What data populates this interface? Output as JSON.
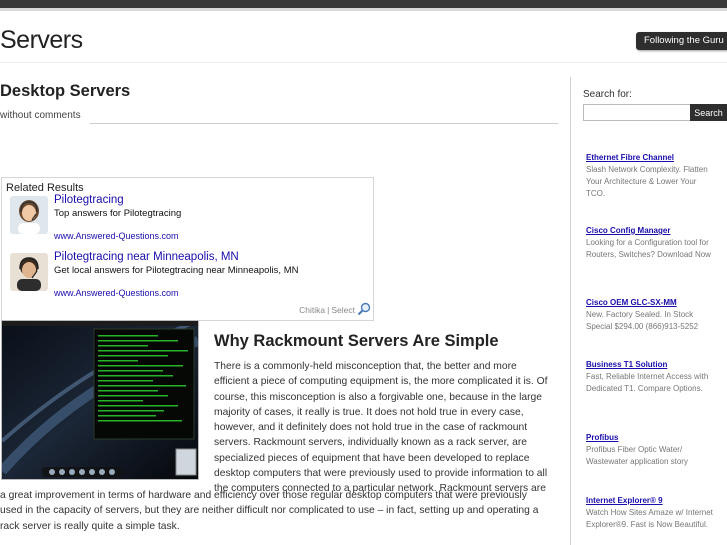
{
  "header": {
    "site_title": "Servers",
    "follow_label": "Following the Guru"
  },
  "post": {
    "title": "Desktop Servers",
    "comments": "without comments"
  },
  "related": {
    "heading": "Related Results",
    "ads": [
      {
        "title": "Pilotegtracing",
        "description": "Top answers for Pilotegtracing",
        "url": "www.Answered-Questions.com"
      },
      {
        "title": "Pilotegtracing near Minneapolis, MN",
        "description": "Get local answers for Pilotegtracing near Minneapolis, MN",
        "url": "www.Answered-Questions.com"
      }
    ],
    "footer_chitika": "Chitika",
    "footer_sep": " | ",
    "footer_select": "Select"
  },
  "article": {
    "title": "Why Rackmount Servers Are Simple",
    "lines_right": [
      "There is a commonly-held misconception that, the better and more",
      "efficient a piece of computing equipment is, the more complicated it is. Of",
      "course, this misconception is also a forgivable one, because in the large",
      "majority of cases, it really is true. It does not hold true in every case,",
      "however, and it definitely does not hold true in the case of rackmount",
      "servers. Rackmount servers, individually known as a rack server, are",
      "specialized pieces of equipment that have been developed to replace",
      "desktop computers that were previously used to provide information to all",
      "the computers connected to a particular network. Rackmount servers are"
    ],
    "lines_full": [
      "a great improvement in terms of hardware and efficiency over those regular desktop computers that were previously",
      "used in the capacity of servers, but they are neither difficult nor complicated to use – in fact, setting up and operating a",
      "rack server is really quite a simple task."
    ]
  },
  "sidebar": {
    "search_label": "Search for:",
    "search_value": "",
    "search_button": "Search",
    "ads": [
      {
        "title": "Ethernet Fibre Channel",
        "description": "Slash Network Complexity. Flatten Your Architecture & Lower Your TCO."
      },
      {
        "title": "Cisco Config Manager",
        "description": "Looking for a Configuration tool for Routers, Switches? Download Now"
      },
      {
        "title": "Cisco OEM GLC-SX-MM",
        "description": "New. Factory Sealed. In Stock Special $294.00 (866)913-5252"
      },
      {
        "title": "Business T1 Solution",
        "description": "Fast, Reliable Internet Access with Dedicated T1. Compare Options."
      },
      {
        "title": "Profibus",
        "description": "Profibus Fiber Optic Water/ Wastewater application story"
      },
      {
        "title": "Internet Explorer® 9",
        "description": "Watch How Sites Amaze w/ Internet Explorer®9. Fast is Now Beautiful."
      }
    ]
  },
  "colors": {
    "link": "#1a0dab",
    "dark": "#2e2e2e"
  }
}
